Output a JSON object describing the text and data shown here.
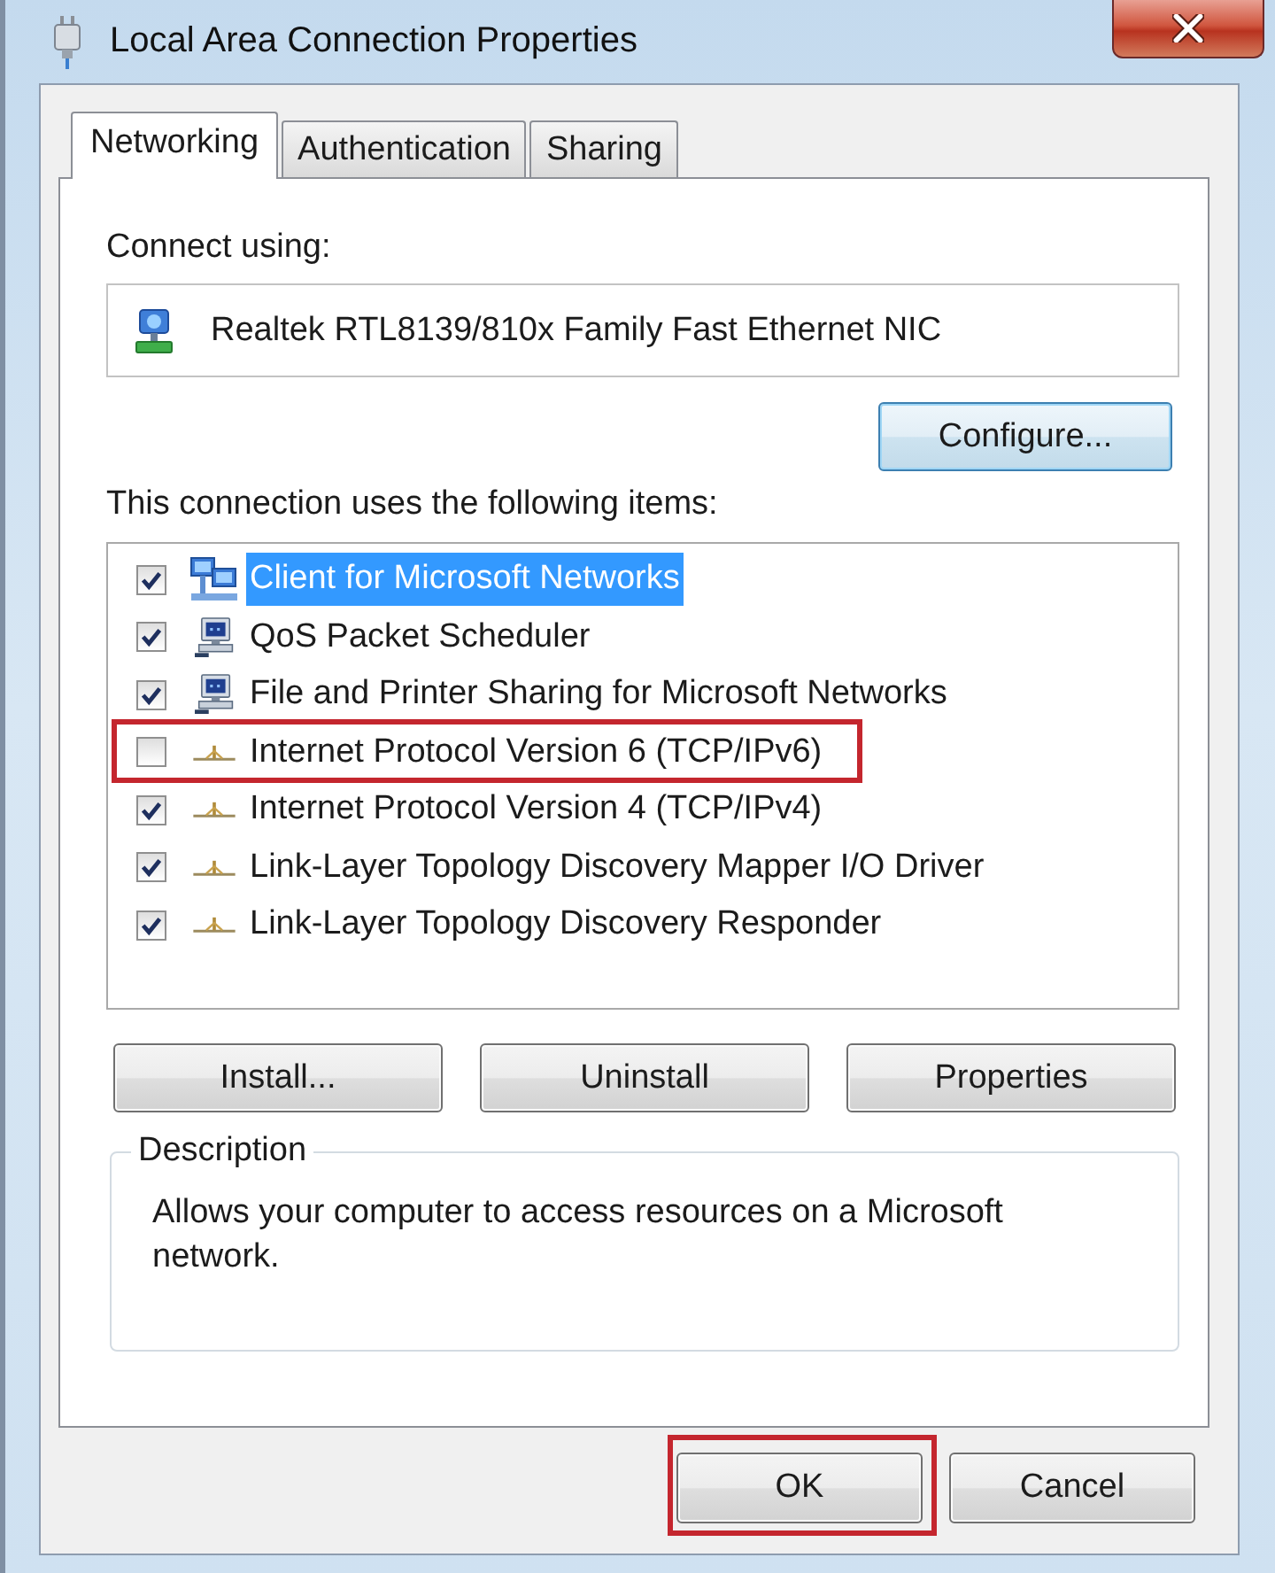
{
  "window": {
    "title": "Local Area Connection Properties"
  },
  "tabs": [
    {
      "label": "Networking",
      "selected": true
    },
    {
      "label": "Authentication",
      "selected": false
    },
    {
      "label": "Sharing",
      "selected": false
    }
  ],
  "connect_using": {
    "label": "Connect using:",
    "adapter": "Realtek RTL8139/810x Family Fast Ethernet NIC",
    "configure_button": {
      "label": "Configure...",
      "focused": true
    }
  },
  "items": {
    "label": "This connection uses the following items:",
    "rows": [
      {
        "label": "Client for Microsoft Networks",
        "kind": "client",
        "checked": true,
        "selected": true,
        "highlighted": false
      },
      {
        "label": "QoS Packet Scheduler",
        "kind": "service",
        "checked": true,
        "selected": false,
        "highlighted": false
      },
      {
        "label": "File and Printer Sharing for Microsoft Networks",
        "kind": "service",
        "checked": true,
        "selected": false,
        "highlighted": false
      },
      {
        "label": "Internet Protocol Version 6 (TCP/IPv6)",
        "kind": "protocol",
        "checked": false,
        "selected": false,
        "highlighted": true
      },
      {
        "label": "Internet Protocol Version 4 (TCP/IPv4)",
        "kind": "protocol",
        "checked": true,
        "selected": false,
        "highlighted": false
      },
      {
        "label": "Link-Layer Topology Discovery Mapper I/O Driver",
        "kind": "protocol",
        "checked": true,
        "selected": false,
        "highlighted": false
      },
      {
        "label": "Link-Layer Topology Discovery Responder",
        "kind": "protocol",
        "checked": true,
        "selected": false,
        "highlighted": false
      }
    ]
  },
  "item_buttons": [
    {
      "label": "Install...",
      "focused": false
    },
    {
      "label": "Uninstall",
      "focused": false
    },
    {
      "label": "Properties",
      "focused": false
    }
  ],
  "description": {
    "label": "Description",
    "text": "Allows your computer to access resources on a Microsoft network."
  },
  "dialog_buttons": [
    {
      "label": "OK",
      "highlighted": true
    },
    {
      "label": "Cancel",
      "highlighted": false
    }
  ]
}
